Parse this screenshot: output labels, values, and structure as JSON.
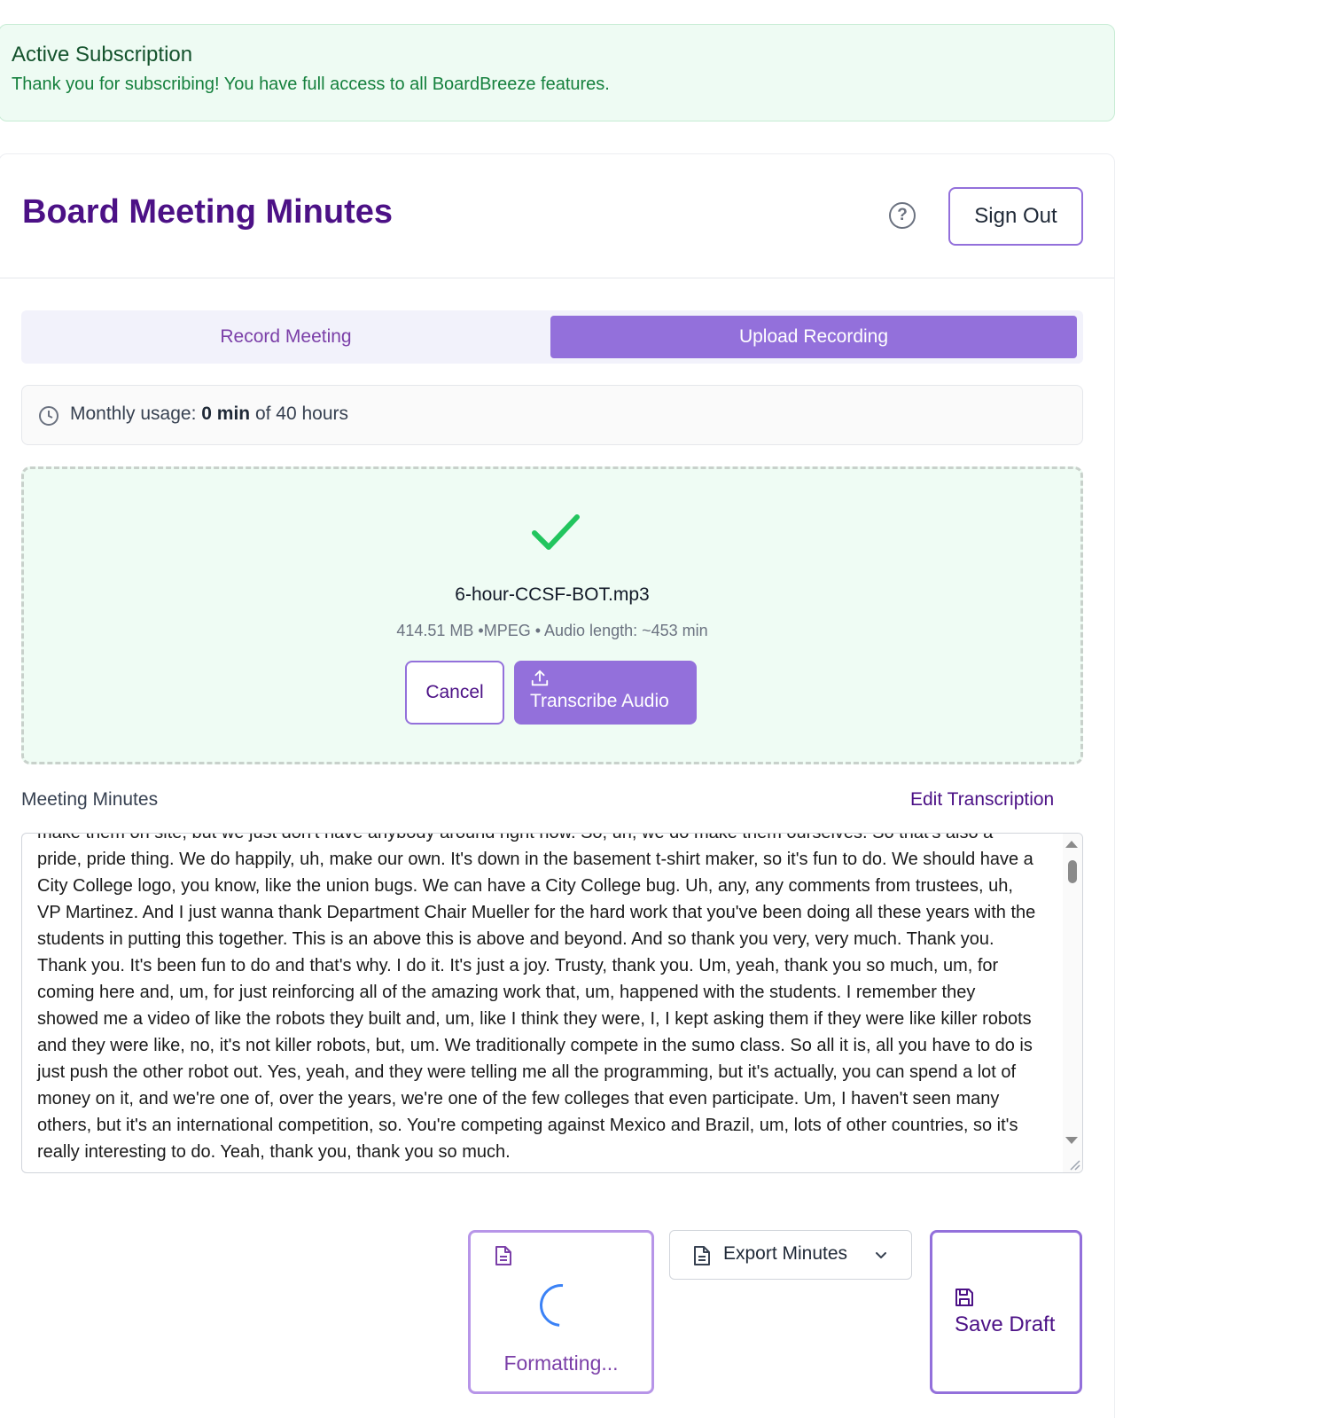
{
  "subscription_banner": {
    "title": "Active Subscription",
    "message": "Thank you for subscribing! You have full access to all BoardBreeze features."
  },
  "header": {
    "title": "Board Meeting Minutes",
    "help_icon": "question-circle-icon",
    "sign_out_label": "Sign Out"
  },
  "tabs": [
    {
      "label": "Record Meeting",
      "active": false
    },
    {
      "label": "Upload Recording",
      "active": true
    }
  ],
  "usage": {
    "prefix": "Monthly usage: ",
    "used": "0 min",
    "suffix": " of 40 hours"
  },
  "upload": {
    "file_name": "6-hour-CCSF-BOT.mp3",
    "file_meta": "414.51 MB •MPEG • Audio length: ~453 min",
    "cancel_label": "Cancel",
    "transcribe_label": "Transcribe Audio"
  },
  "minutes": {
    "label": "Meeting Minutes",
    "edit_label": "Edit Transcription",
    "transcript": "make them on site, but we just don't have anybody around right now. So, uh, we do make them ourselves. So that's also a pride, pride thing. We do happily, uh, make our own. It's down in the basement t-shirt maker, so it's fun to do. We should have a City College logo, you know, like the union bugs. We can have a City College bug. Uh, any, any comments from trustees, uh, VP Martinez. And I just wanna thank Department Chair Mueller for the hard work that you've been doing all these years with the students in putting this together. This is an above this is above and beyond. And so thank you very, very much. Thank you. Thank you. It's been fun to do and that's why. I do it. It's just a joy. Trusty, thank you. Um, yeah, thank you so much, um, for coming here and, um, for just reinforcing all of the amazing work that, um, happened with the students. I remember they showed me a video of like the robots they built and, um, like I think they were, I, I kept asking them if they were like killer robots and they were like, no, it's not killer robots, but, um. We traditionally compete in the sumo class. So all it is, all you have to do is just push the other robot out. Yes, yeah, and they were telling me all the programming, but it's actually, you can spend a lot of money on it, and we're one of, over the years, we're one of the few colleges that even participate. Um, I haven't seen many others, but it's an international competition, so. You're competing against Mexico and Brazil, um, lots of other countries, so it's really interesting to do. Yeah, thank you, thank you so much."
  },
  "actions": {
    "format_label": "Formatting...",
    "export_label": "Export Minutes",
    "save_label": "Save Draft"
  },
  "colors": {
    "brand_purple": "#9370db",
    "title_purple": "#4c1186",
    "success_green": "#22c55e",
    "spinner_blue": "#3b82f6"
  }
}
